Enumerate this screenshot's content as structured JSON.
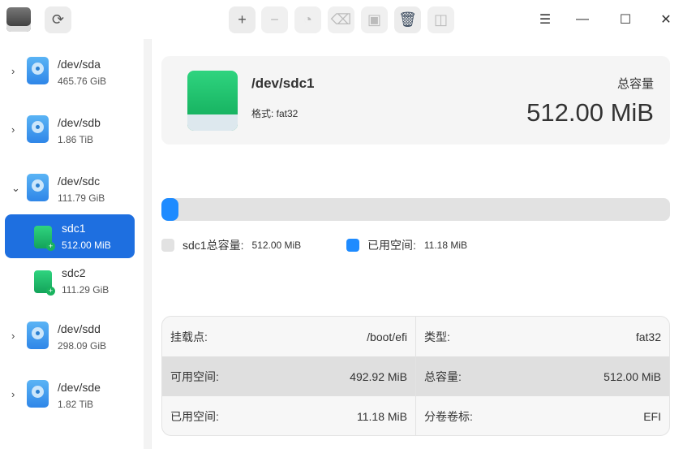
{
  "toolbar": {
    "buttons": [
      "add",
      "remove",
      "partition",
      "erase",
      "restore",
      "delete",
      "split"
    ],
    "window": [
      "menu",
      "minimize",
      "maximize",
      "close"
    ]
  },
  "sidebar": {
    "disks": [
      {
        "name": "/dev/sda",
        "size": "465.76 GiB"
      },
      {
        "name": "/dev/sdb",
        "size": "1.86 TiB"
      },
      {
        "name": "/dev/sdc",
        "size": "111.79 GiB",
        "partitions": [
          {
            "name": "sdc1",
            "size": "512.00 MiB"
          },
          {
            "name": "sdc2",
            "size": "111.29 GiB"
          }
        ]
      },
      {
        "name": "/dev/sdd",
        "size": "298.09 GiB"
      },
      {
        "name": "/dev/sde",
        "size": "1.82 TiB"
      }
    ]
  },
  "detail": {
    "name": "/dev/sdc1",
    "format": "格式: fat32",
    "capacity_label": "总容量",
    "capacity": "512.00 MiB"
  },
  "usage": {
    "used_fraction": 0.0218,
    "total_label": "sdc1总容量:",
    "total": "512.00 MiB",
    "used_label": "已用空间:",
    "used": "11.18 MiB",
    "colors": {
      "used": "#1e8bff",
      "total": "#e2e2e2"
    }
  },
  "info": [
    [
      {
        "k": "挂载点:",
        "v": "/boot/efi"
      },
      {
        "k": "类型:",
        "v": "fat32"
      }
    ],
    [
      {
        "k": "可用空间:",
        "v": "492.92 MiB"
      },
      {
        "k": "总容量:",
        "v": "512.00 MiB"
      }
    ],
    [
      {
        "k": "已用空间:",
        "v": "11.18 MiB"
      },
      {
        "k": "分卷卷标:",
        "v": "EFI"
      }
    ]
  ]
}
